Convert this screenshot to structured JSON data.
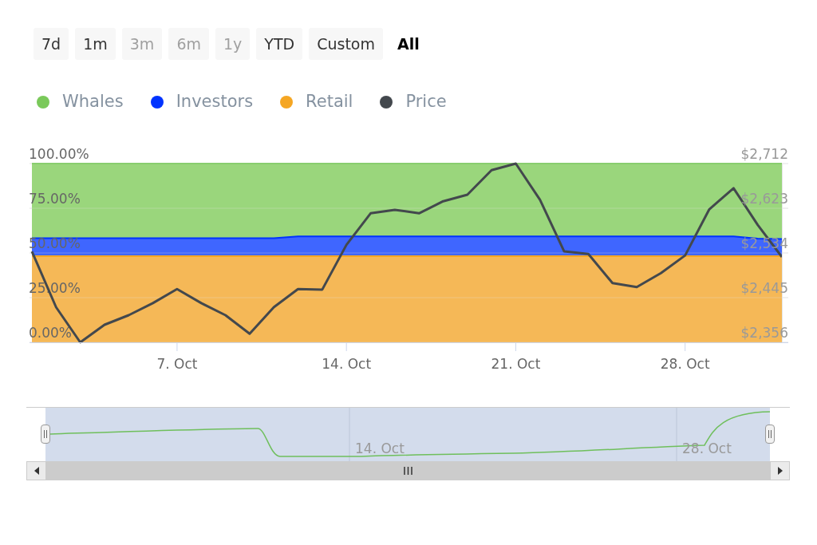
{
  "range_buttons": [
    {
      "label": "7d",
      "disabled": false,
      "selected": false
    },
    {
      "label": "1m",
      "disabled": false,
      "selected": false
    },
    {
      "label": "3m",
      "disabled": true,
      "selected": false
    },
    {
      "label": "6m",
      "disabled": true,
      "selected": false
    },
    {
      "label": "1y",
      "disabled": true,
      "selected": false
    },
    {
      "label": "YTD",
      "disabled": false,
      "selected": false
    },
    {
      "label": "Custom",
      "disabled": false,
      "selected": false
    },
    {
      "label": "All",
      "disabled": false,
      "selected": true
    }
  ],
  "holder_chart": {
    "chart_data": {
      "type": "area",
      "stacked": true,
      "grid": true,
      "ylim": [
        0,
        100
      ],
      "yticks": [
        {
          "value": 0,
          "label": "0.00%"
        },
        {
          "value": 25,
          "label": "25.00%"
        },
        {
          "value": 50,
          "label": "50.00%"
        },
        {
          "value": 75,
          "label": "75.00%"
        },
        {
          "value": 100,
          "label": "100.00%"
        }
      ],
      "series": [
        {
          "name": "Retail",
          "color": "#f5a623",
          "values": [
            48.2,
            48.2,
            48.2,
            48.2,
            48.2,
            48.2,
            48.2,
            48.2,
            48.2,
            48.2,
            48.2,
            48.2,
            48.2,
            48.2,
            48.2,
            48.2,
            48.2,
            48.2,
            48.2,
            48.2,
            48.2,
            48.2,
            48.2,
            48.2,
            48.2,
            48.2,
            48.2,
            48.2,
            48.2,
            48.2,
            48.2,
            48.2
          ]
        },
        {
          "name": "Investors",
          "color": "#0033ff",
          "values": [
            10.0,
            10.0,
            10.0,
            10.0,
            10.0,
            10.0,
            10.0,
            10.0,
            10.0,
            10.0,
            10.0,
            11.1,
            11.1,
            11.1,
            11.1,
            11.1,
            11.1,
            11.1,
            11.1,
            11.1,
            11.1,
            11.1,
            11.1,
            11.1,
            11.1,
            11.1,
            11.1,
            11.1,
            11.1,
            11.1,
            9.8,
            9.6
          ]
        },
        {
          "name": "Whales",
          "color": "#7ac95a",
          "values": [
            41.8,
            41.8,
            41.8,
            41.8,
            41.8,
            41.8,
            41.8,
            41.8,
            41.8,
            41.8,
            41.8,
            40.7,
            40.7,
            40.7,
            40.7,
            40.7,
            40.7,
            40.7,
            40.7,
            40.7,
            40.7,
            40.7,
            40.7,
            40.7,
            40.7,
            40.7,
            40.7,
            40.7,
            40.7,
            40.7,
            42.0,
            42.2
          ]
        }
      ]
    }
  },
  "price_chart": {
    "chart_data": {
      "type": "line",
      "grid": true,
      "categories": [
        null,
        null,
        null,
        null,
        null,
        null,
        "7. Oct",
        null,
        null,
        null,
        null,
        null,
        null,
        "14. Oct",
        null,
        null,
        null,
        null,
        null,
        null,
        "21. Oct",
        null,
        null,
        null,
        null,
        null,
        null,
        "28. Oct",
        null,
        null,
        null,
        null
      ],
      "ylim": [
        2356,
        2712
      ],
      "yticks": [
        {
          "value": 2356,
          "label": "$2,356"
        },
        {
          "value": 2445,
          "label": "$2,445"
        },
        {
          "value": 2534,
          "label": "$2,534"
        },
        {
          "value": 2623,
          "label": "$2,623"
        },
        {
          "value": 2712,
          "label": "$2,712"
        }
      ],
      "series": [
        {
          "name": "Price",
          "color": "#43484d",
          "values": [
            2537,
            2426,
            2356,
            2391,
            2410,
            2434,
            2462,
            2434,
            2410,
            2373,
            2426,
            2462,
            2461,
            2550,
            2613,
            2620,
            2613,
            2637,
            2650,
            2699,
            2712,
            2640,
            2537,
            2532,
            2474,
            2466,
            2494,
            2529,
            2621,
            2663,
            2590,
            2526
          ]
        }
      ]
    }
  },
  "navigator": {
    "labels": [
      "14. Oct",
      "28. Oct"
    ]
  }
}
